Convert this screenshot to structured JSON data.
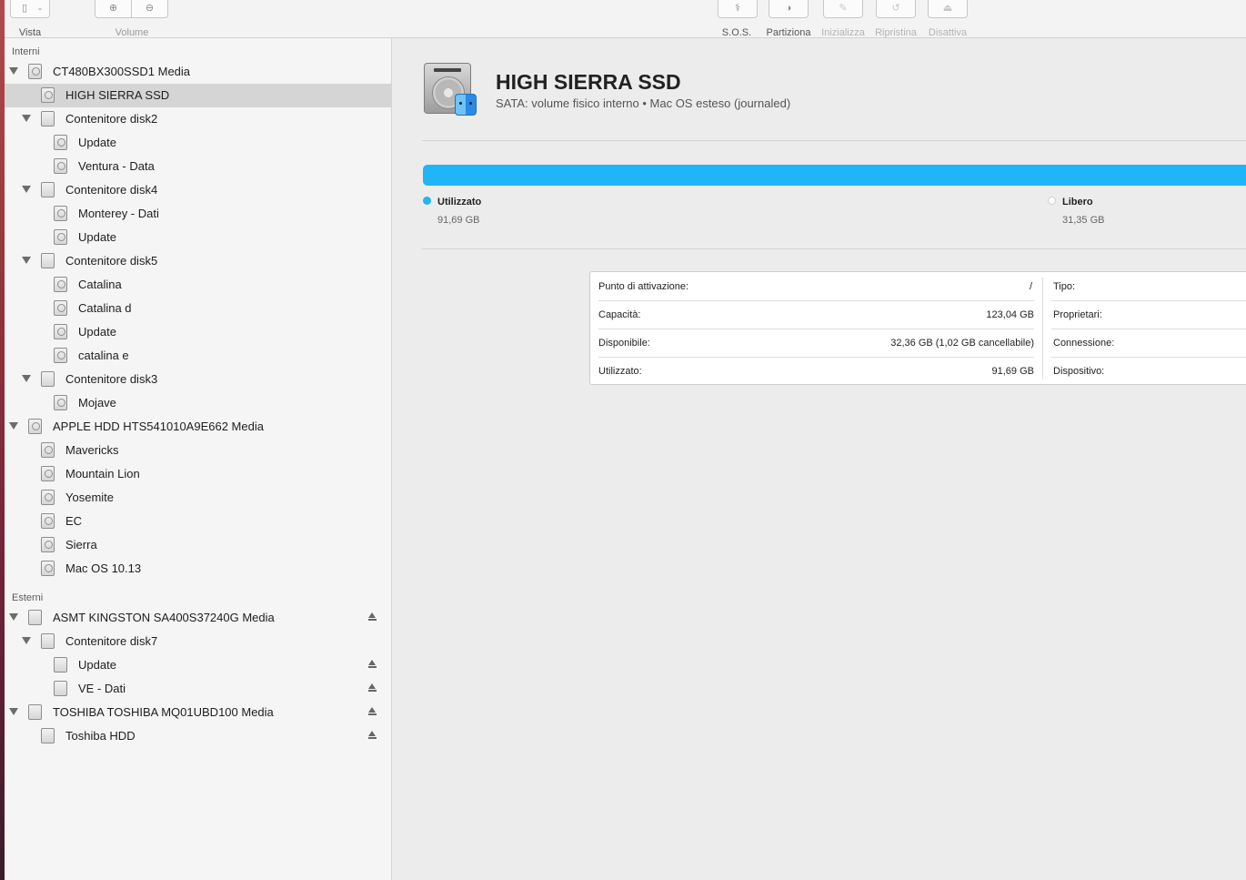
{
  "toolbar": {
    "vista_label": "Vista",
    "volume_label": "Volume",
    "sos_label": "S.O.S.",
    "partiziona_label": "Partiziona",
    "inizializza_label": "Inizializza",
    "ripristina_label": "Ripristina",
    "disattiva_label": "Disattiva"
  },
  "sidebar": {
    "internal_title": "Interni",
    "external_title": "Esterni",
    "internal": [
      {
        "label": "CT480BX300SSD1 Media"
      },
      {
        "label": "HIGH SIERRA SSD"
      },
      {
        "label": "Contenitore disk2"
      },
      {
        "label": "Update"
      },
      {
        "label": "Ventura - Data"
      },
      {
        "label": "Contenitore disk4"
      },
      {
        "label": "Monterey - Dati"
      },
      {
        "label": "Update"
      },
      {
        "label": "Contenitore disk5"
      },
      {
        "label": "Catalina"
      },
      {
        "label": "Catalina d"
      },
      {
        "label": "Update"
      },
      {
        "label": "catalina e"
      },
      {
        "label": "Contenitore disk3"
      },
      {
        "label": "Mojave"
      },
      {
        "label": "APPLE HDD HTS541010A9E662 Media"
      },
      {
        "label": "Mavericks"
      },
      {
        "label": "Mountain Lion"
      },
      {
        "label": "Yosemite"
      },
      {
        "label": "EC"
      },
      {
        "label": "Sierra"
      },
      {
        "label": "Mac OS 10.13"
      }
    ],
    "external": [
      {
        "label": "ASMT KINGSTON SA400S37240G Media"
      },
      {
        "label": "Contenitore disk7"
      },
      {
        "label": "Update"
      },
      {
        "label": "VE - Dati"
      },
      {
        "label": "TOSHIBA TOSHIBA MQ01UBD100 Media"
      },
      {
        "label": "Toshiba HDD"
      }
    ]
  },
  "main": {
    "title": "HIGH SIERRA SSD",
    "subtitle": "SATA: volume fisico interno • Mac OS esteso (journaled)",
    "usage": {
      "used_fraction": 0.745,
      "used_color": "#1fb5f6",
      "used_label": "Utilizzato",
      "used_value": "91,69 GB",
      "free_label": "Libero",
      "free_value": "31,35 GB"
    },
    "info": {
      "mount_label": "Punto di attivazione:",
      "mount_value": "/",
      "capacity_label": "Capacità:",
      "capacity_value": "123,04 GB",
      "available_label": "Disponibile:",
      "available_value": "32,36 GB (1,02 GB cancellabile)",
      "used_label": "Utilizzato:",
      "used_value": "91,69 GB",
      "type_label": "Tipo:",
      "owners_label": "Proprietari:",
      "connection_label": "Connessione:",
      "device_label": "Dispositivo:"
    }
  }
}
